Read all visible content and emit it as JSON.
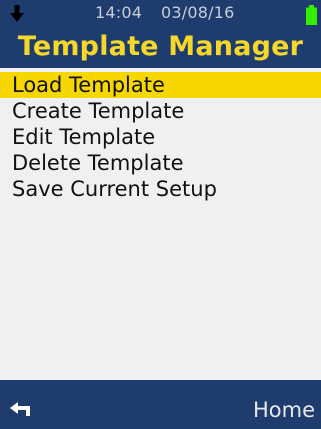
{
  "status": {
    "time": "14:04",
    "date": "03/08/16"
  },
  "header": {
    "title": "Template Manager"
  },
  "menu": {
    "items": [
      {
        "label": "Load Template",
        "selected": true
      },
      {
        "label": "Create Template",
        "selected": false
      },
      {
        "label": "Edit Template",
        "selected": false
      },
      {
        "label": "Delete Template",
        "selected": false
      },
      {
        "label": "Save Current Setup",
        "selected": false
      }
    ]
  },
  "footer": {
    "back_icon": "back-arrow-icon",
    "home_label": "Home"
  },
  "colors": {
    "header_background": "#1e3d6e",
    "title_color": "#f7d82a",
    "selection_highlight": "#f7d700",
    "battery_color": "#33ee00"
  }
}
